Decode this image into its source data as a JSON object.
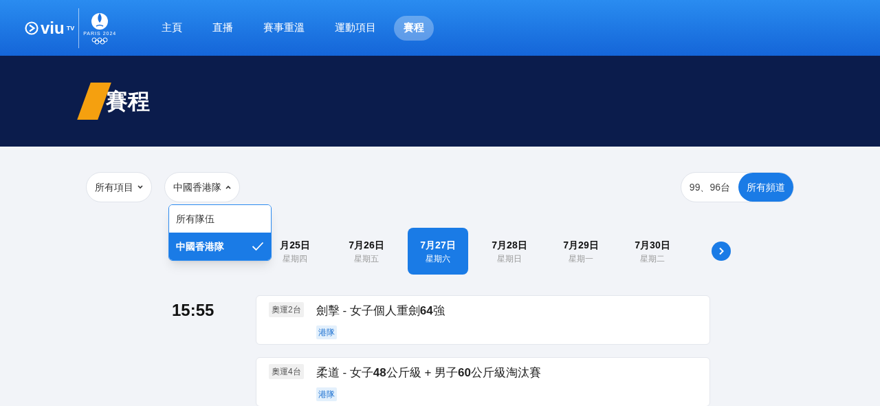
{
  "logo": {
    "brand": "viu",
    "brand_suffix": "TV",
    "games": "PARIS 2024"
  },
  "nav": [
    {
      "label": "主頁",
      "selected": false
    },
    {
      "label": "直播",
      "selected": false
    },
    {
      "label": "賽事重溫",
      "selected": false
    },
    {
      "label": "運動項目",
      "selected": false
    },
    {
      "label": "賽程",
      "selected": true
    }
  ],
  "page_title": "賽程",
  "filters": [
    {
      "label": "所有項目",
      "expanded": false
    },
    {
      "label": "中國香港隊",
      "expanded": true
    }
  ],
  "team_menu": [
    {
      "label": "所有隊伍",
      "selected": false
    },
    {
      "label": "中國香港隊",
      "selected": true
    }
  ],
  "channels": [
    {
      "label": "99、96台",
      "selected": false
    },
    {
      "label": "所有頻道",
      "selected": true
    }
  ],
  "dates": [
    {
      "date": "月25日",
      "weekday": "星期四",
      "selected": false
    },
    {
      "date": "7月26日",
      "weekday": "星期五",
      "selected": false
    },
    {
      "date": "7月27日",
      "weekday": "星期六",
      "selected": true
    },
    {
      "date": "7月28日",
      "weekday": "星期日",
      "selected": false
    },
    {
      "date": "7月29日",
      "weekday": "星期一",
      "selected": false
    },
    {
      "date": "7月30日",
      "weekday": "星期二",
      "selected": false
    }
  ],
  "schedule": [
    {
      "time": "15:55",
      "events": [
        {
          "channel": "奧運2台",
          "title": "劍擊 - 女子個人重劍**64**強",
          "tag": "港隊"
        },
        {
          "channel": "奧運4台",
          "title": "柔道 - 女子**48**公斤級 + 男子**60**公斤級淘汰賽",
          "tag": "港隊"
        }
      ]
    }
  ]
}
